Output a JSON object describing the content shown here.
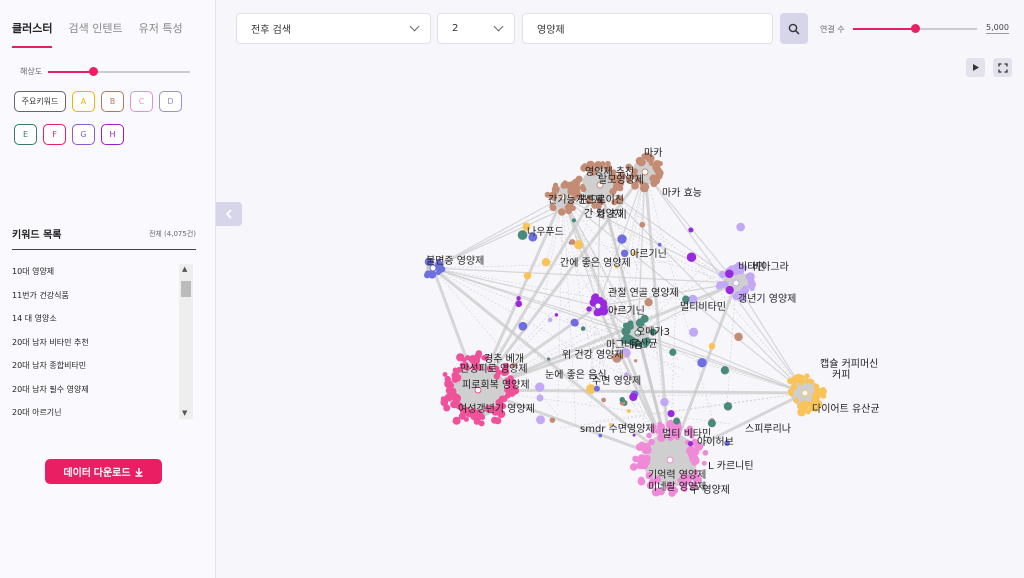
{
  "tabs": [
    {
      "label": "클러스터",
      "active": true
    },
    {
      "label": "검색 인텐트",
      "active": false
    },
    {
      "label": "유저 특성",
      "active": false
    }
  ],
  "resolution": {
    "label": "해상도",
    "value_fraction": 0.32
  },
  "clusters": [
    {
      "label": "주요키워드",
      "color": "#666666"
    },
    {
      "label": "A",
      "color": "#f0b400"
    },
    {
      "label": "B",
      "color": "#b07a5e"
    },
    {
      "label": "C",
      "color": "#e88fd6"
    },
    {
      "label": "D",
      "color": "#9a8fe0"
    },
    {
      "label": "E",
      "color": "#3a7a6a"
    },
    {
      "label": "F",
      "color": "#e91e63"
    },
    {
      "label": "G",
      "color": "#8a5ad8"
    },
    {
      "label": "H",
      "color": "#a020c8"
    }
  ],
  "keyword_list": {
    "title": "키워드 목록",
    "total": "전체 (4,075건)",
    "items": [
      "10대 영양제",
      "11번가 건강식품",
      "14 대 영양소",
      "20대 남자 비타민 추천",
      "20대 남자 종합비타민",
      "20대 남자 필수 영양제",
      "20대 아르기닌"
    ]
  },
  "download_label": "데이터 다운로드",
  "search": {
    "mode": "전후 검색",
    "depth": "2",
    "query": "영양제"
  },
  "connections": {
    "label": "연결 수",
    "value": "5,000",
    "value_fraction": 0.5
  },
  "icons": {
    "play": "play-icon",
    "fullscreen": "fullscreen-icon",
    "search": "search-icon",
    "collapse": "chevron-left-icon",
    "download": "download-icon"
  },
  "graph": {
    "clusters": [
      {
        "name": "pink",
        "color": "#f0529a"
      },
      {
        "name": "light-pink",
        "color": "#f08ad8"
      },
      {
        "name": "brown",
        "color": "#c48c74"
      },
      {
        "name": "violet",
        "color": "#c3a8f5"
      },
      {
        "name": "yellow",
        "color": "#f8c45a"
      },
      {
        "name": "blue",
        "color": "#6d6fe0"
      },
      {
        "name": "teal",
        "color": "#4a8a7c"
      },
      {
        "name": "purple",
        "color": "#9a28e0"
      }
    ],
    "labels": [
      "영양제 추천",
      "마카",
      "탈모영양제",
      "마카 효능",
      "간기능개선제",
      "콘드로이친",
      "간 영양제",
      "차 조기",
      "나우푸드",
      "불면증 영양제",
      "간에 좋은 영양제",
      "아르기닌",
      "비타민",
      "비아그라",
      "관절 연골 영양제",
      "멀티비타민",
      "아르기닌",
      "갱년기 영양제",
      "오메가3",
      "유산균",
      "마그네슘",
      "위 건강 영양제",
      "경추 베개",
      "만성피로 영양제",
      "피로회복 영양제",
      "눈에 좋은 음식",
      "수면 영양제",
      "여성갱년기 영양제",
      "smdr 수면영양제",
      "멀티 비타민",
      "기억력 영양제",
      "미네랄 영양제",
      "아이허브",
      "커피",
      "캡슐 커피머신",
      "다이어트 유산균",
      "스피루리나",
      "L 카르니틴",
      "구 영양제"
    ]
  }
}
